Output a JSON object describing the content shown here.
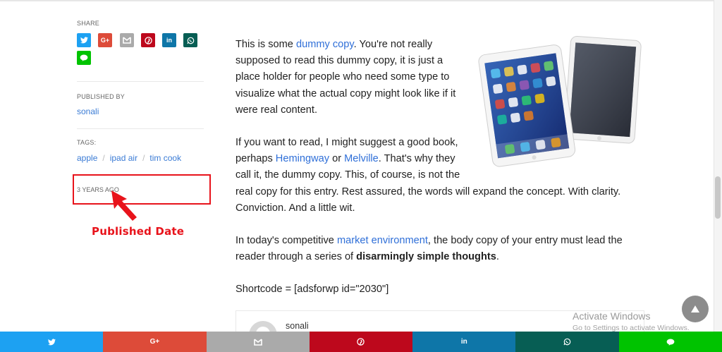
{
  "sidebar": {
    "share_label": "SHARE",
    "share_buttons": [
      {
        "name": "twitter",
        "icon": "twitter-icon",
        "glyph": "",
        "color": "#1da1f2"
      },
      {
        "name": "google-plus",
        "icon": "google-plus-icon",
        "glyph": "G+",
        "color": "#dd4b39"
      },
      {
        "name": "email",
        "icon": "mail-icon",
        "glyph": "",
        "color": "#aaaaaa"
      },
      {
        "name": "pinterest",
        "icon": "pinterest-icon",
        "glyph": "",
        "color": "#bd081c"
      },
      {
        "name": "linkedin",
        "icon": "linkedin-icon",
        "glyph": "in",
        "color": "#0e76a8"
      },
      {
        "name": "whatsapp",
        "icon": "whatsapp-icon",
        "glyph": "",
        "color": "#075e54"
      },
      {
        "name": "line",
        "icon": "line-icon",
        "glyph": "",
        "color": "#00c300"
      }
    ],
    "published_by_label": "PUBLISHED BY",
    "author": "sonali",
    "tags_label": "TAGS:",
    "tags": [
      "apple",
      "ipad air",
      "tim cook"
    ],
    "age": "3 YEARS AGO"
  },
  "annotation": {
    "label": "Published Date",
    "color": "#e8131b"
  },
  "article": {
    "p1_a": "This is some ",
    "p1_link": "dummy copy",
    "p1_b": ". You're not really supposed to read this dummy copy, it is just a place holder for people who need some type to visualize what the actual copy might look like if it were real content.",
    "p2_a": "If you want to read, I might suggest a good book, perhaps ",
    "p2_link1": "Hemingway",
    "p2_b": " or ",
    "p2_link2": "Melville",
    "p2_c": ". That's why they call it, the dummy copy. This, of course, is not the",
    "p2_d": "real copy for this entry. Rest assured, the words will expand the concept. With clarity. Conviction. And a little wit.",
    "p3_a": "In today's competitive ",
    "p3_link": "market environment",
    "p3_b": ", the body copy of your entry must lead the reader through a series of ",
    "p3_bold": "disarmingly simple thoughts",
    "p3_c": ".",
    "p4": "Shortcode = [adsforwp id=\"2030\"]"
  },
  "author_box": {
    "name": "sonali"
  },
  "watermark": {
    "title": "Activate Windows",
    "subtitle": "Go to Settings to activate Windows."
  },
  "share_bar": [
    {
      "name": "twitter",
      "icon": "twitter-icon",
      "glyph": "",
      "color": "#1da1f2"
    },
    {
      "name": "google-plus",
      "icon": "google-plus-icon",
      "glyph": "G+",
      "color": "#dd4b39"
    },
    {
      "name": "email",
      "icon": "mail-icon",
      "glyph": "",
      "color": "#aaaaaa"
    },
    {
      "name": "pinterest",
      "icon": "pinterest-icon",
      "glyph": "",
      "color": "#bd081c"
    },
    {
      "name": "linkedin",
      "icon": "linkedin-icon",
      "glyph": "in",
      "color": "#0e76a8"
    },
    {
      "name": "whatsapp",
      "icon": "whatsapp-icon",
      "glyph": "",
      "color": "#075e54"
    },
    {
      "name": "line",
      "icon": "line-icon",
      "glyph": "",
      "color": "#00c300"
    }
  ]
}
